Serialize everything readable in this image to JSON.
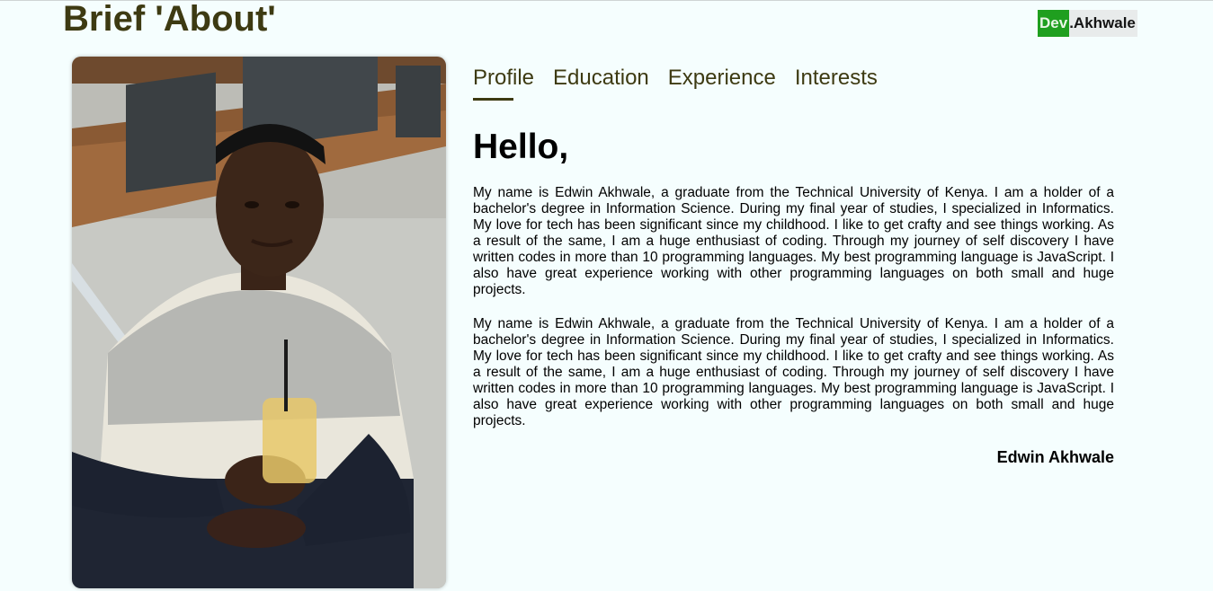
{
  "header": {
    "title": "Brief 'About'",
    "logo": {
      "prefix": "Dev",
      "suffix": ".Akhwale"
    }
  },
  "tabs": [
    {
      "label": "Profile",
      "active": true
    },
    {
      "label": "Education",
      "active": false
    },
    {
      "label": "Experience",
      "active": false
    },
    {
      "label": "Interests",
      "active": false
    }
  ],
  "profile": {
    "greeting": "Hello,",
    "paragraphs": [
      "My name is Edwin Akhwale, a graduate from the Technical University of Kenya. I am a holder of a bachelor's degree in Information Science. During my final year of studies, I specialized in Informatics. My love for tech has been significant since my childhood. I like to get crafty and see things working. As a result of the same, I am a huge enthusiast of coding. Through my journey of self discovery I have written codes in more than 10 programming languages. My best programming language is JavaScript. I also have great experience working with other programming languages on both small and huge projects.",
      "My name is Edwin Akhwale, a graduate from the Technical University of Kenya. I am a holder of a bachelor's degree in Information Science. During my final year of studies, I specialized in Informatics. My love for tech has been significant since my childhood. I like to get crafty and see things working. As a result of the same, I am a huge enthusiast of coding. Through my journey of self discovery I have written codes in more than 10 programming languages. My best programming language is JavaScript. I also have great experience working with other programming languages on both small and huge projects."
    ],
    "signature": "Edwin Akhwale"
  },
  "colors": {
    "background": "#f5fefe",
    "accent": "#3d3a12",
    "logo_green": "#1f9f1f"
  }
}
